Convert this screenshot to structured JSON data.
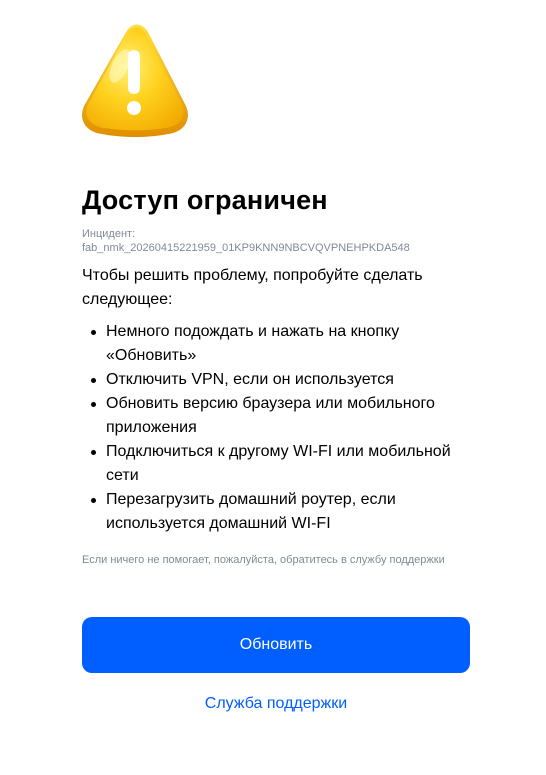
{
  "colors": {
    "accent": "#005ffe",
    "muted_text": "#808a96",
    "icon_yellow": "#ffd21f",
    "icon_shadow": "#e59a00"
  },
  "icon": "warning-triangle-icon",
  "title": "Доступ ограничен",
  "incident": {
    "label": "Инцидент:",
    "id": "fab_nmk_20260415221959_01KP9KNN9NBCVQVPNEHPKDA548"
  },
  "intro": "Чтобы решить проблему, попробуйте сделать следующее:",
  "steps": [
    "Немного подождать и нажать на кнопку «Обновить»",
    "Отключить VPN, если он используется",
    "Обновить версию браузера или мобильного приложения",
    "Подключиться к другому WI-FI или мобильной сети",
    "Перезагрузить домашний роутер, если используется домашний WI-FI"
  ],
  "help_note": "Если ничего не помогает, пожалуйста, обратитесь в службу поддержки",
  "refresh_label": "Обновить",
  "support_label": "Служба поддержки"
}
